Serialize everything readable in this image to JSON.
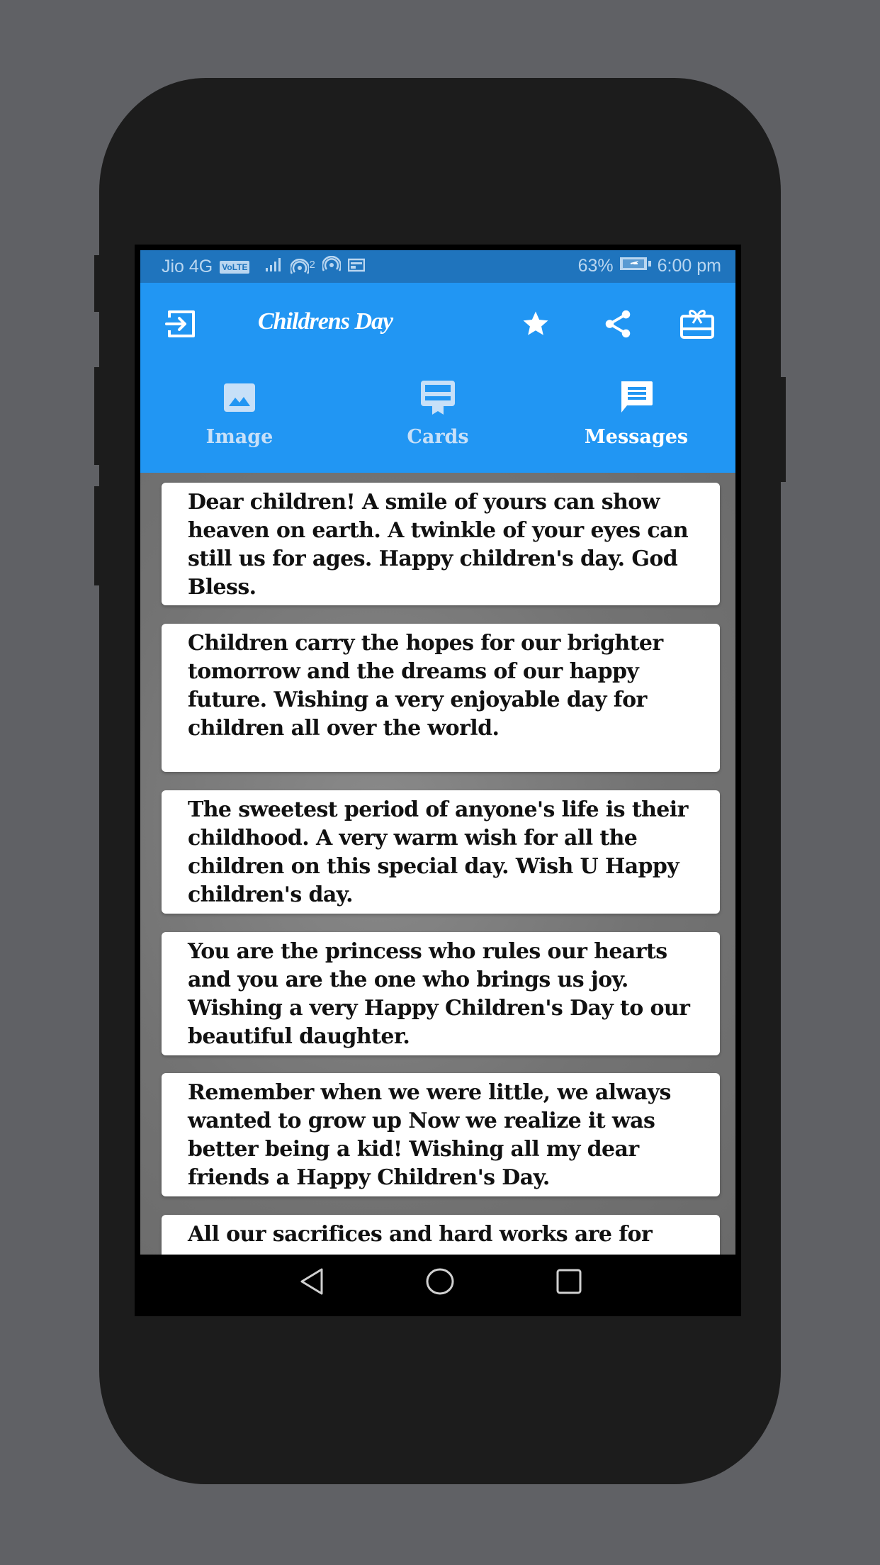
{
  "status_bar": {
    "carrier": "Jio 4G",
    "volte_badge": "VoLTE",
    "hotspot_count": "2",
    "battery_percent": "63%",
    "time": "6:00 pm"
  },
  "app_bar": {
    "title": "Childrens Day",
    "icons": [
      "exit-icon",
      "star-icon",
      "share-icon",
      "gift-card-icon"
    ]
  },
  "tabs": [
    {
      "label": "Image",
      "icon": "image-icon",
      "active": false
    },
    {
      "label": "Cards",
      "icon": "card-icon",
      "active": false
    },
    {
      "label": "Messages",
      "icon": "message-icon",
      "active": true
    }
  ],
  "messages": [
    "Dear children! A smile of yours can show heaven on earth. A twinkle of your eyes can still us for ages. Happy children's day. God Bless.",
    "Children carry the hopes for our brighter tomorrow and the dreams of our happy future. Wishing a very enjoyable day for children all over the world.",
    "The sweetest period of anyone's life is their childhood. A very warm wish for all the children on this special day. Wish U Happy children's day.",
    "You are the princess who rules our hearts and you are the one who brings us joy. Wishing a very Happy Children's Day to our beautiful daughter.",
    "Remember when we were little, we always wanted to grow up Now we realize it was better being a kid! Wishing all my dear friends a Happy Children's Day.",
    "All our sacrifices and hard works are for"
  ],
  "nav_bar": {
    "buttons": [
      "back-icon",
      "home-icon",
      "recents-icon"
    ]
  },
  "colors": {
    "primary": "#2196f3",
    "status_bar": "#1f74bd",
    "tab_inactive_text": "#c7e0f8",
    "card_bg": "#ffffff",
    "phone_frame": "#1c1c1c",
    "page_bg": "#606165"
  }
}
